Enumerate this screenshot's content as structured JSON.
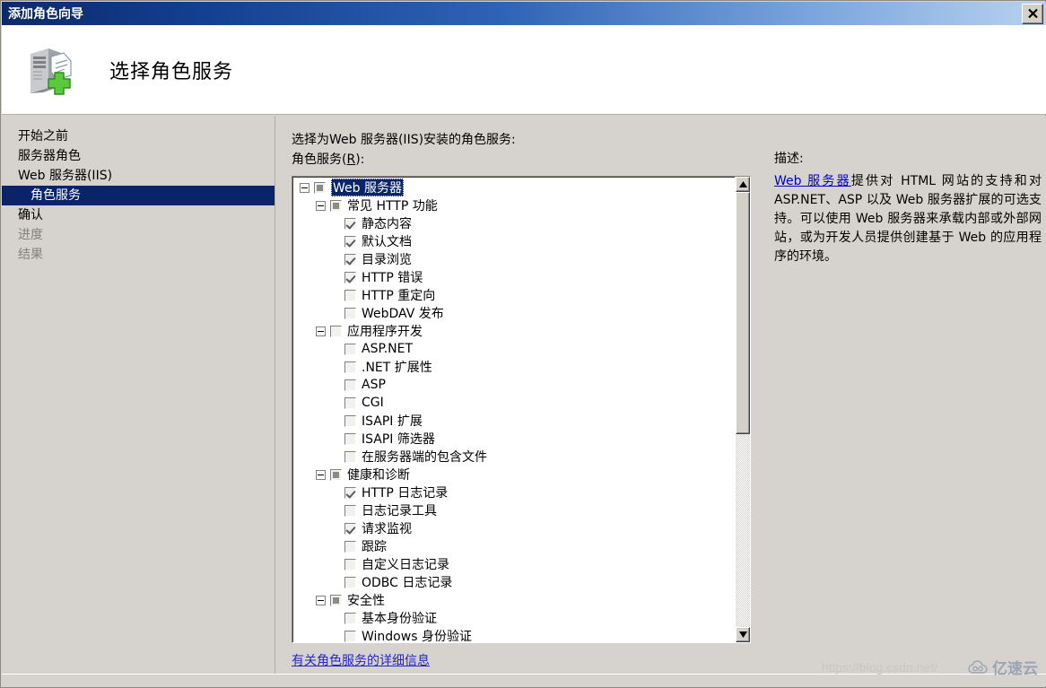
{
  "window": {
    "title": "添加角色向导",
    "close_label": "×"
  },
  "header": {
    "title": "选择角色服务",
    "icon": "server-add-icon"
  },
  "sidebar": {
    "items": [
      {
        "label": "开始之前",
        "state": "normal"
      },
      {
        "label": "服务器角色",
        "state": "normal"
      },
      {
        "label": "Web 服务器(IIS)",
        "state": "normal"
      },
      {
        "label": "角色服务",
        "state": "selected"
      },
      {
        "label": "确认",
        "state": "normal"
      },
      {
        "label": "进度",
        "state": "disabled"
      },
      {
        "label": "结果",
        "state": "disabled"
      }
    ]
  },
  "main": {
    "instruction": "选择为Web 服务器(IIS)安装的角色服务:",
    "tree_label_prefix": "角色服务(",
    "tree_label_accesskey": "R",
    "tree_label_suffix": "):",
    "more_info_link": "有关角色服务的详细信息",
    "tree": [
      {
        "label": "Web 服务器",
        "indent": 0,
        "check": "partial",
        "expander": "minus",
        "selected": true
      },
      {
        "label": "常见 HTTP 功能",
        "indent": 1,
        "check": "partial",
        "expander": "minus",
        "selected": false
      },
      {
        "label": "静态内容",
        "indent": 2,
        "check": "checked",
        "expander": "none",
        "selected": false
      },
      {
        "label": "默认文档",
        "indent": 2,
        "check": "checked",
        "expander": "none",
        "selected": false
      },
      {
        "label": "目录浏览",
        "indent": 2,
        "check": "checked",
        "expander": "none",
        "selected": false
      },
      {
        "label": "HTTP 错误",
        "indent": 2,
        "check": "checked",
        "expander": "none",
        "selected": false
      },
      {
        "label": "HTTP 重定向",
        "indent": 2,
        "check": "unchecked",
        "expander": "none",
        "selected": false
      },
      {
        "label": "WebDAV 发布",
        "indent": 2,
        "check": "unchecked",
        "expander": "none",
        "selected": false
      },
      {
        "label": "应用程序开发",
        "indent": 1,
        "check": "unchecked",
        "expander": "minus",
        "selected": false
      },
      {
        "label": "ASP.NET",
        "indent": 2,
        "check": "unchecked",
        "expander": "none",
        "selected": false
      },
      {
        "label": ".NET 扩展性",
        "indent": 2,
        "check": "unchecked",
        "expander": "none",
        "selected": false
      },
      {
        "label": "ASP",
        "indent": 2,
        "check": "unchecked",
        "expander": "none",
        "selected": false
      },
      {
        "label": "CGI",
        "indent": 2,
        "check": "unchecked",
        "expander": "none",
        "selected": false
      },
      {
        "label": "ISAPI 扩展",
        "indent": 2,
        "check": "unchecked",
        "expander": "none",
        "selected": false
      },
      {
        "label": "ISAPI 筛选器",
        "indent": 2,
        "check": "unchecked",
        "expander": "none",
        "selected": false
      },
      {
        "label": "在服务器端的包含文件",
        "indent": 2,
        "check": "unchecked",
        "expander": "none",
        "selected": false
      },
      {
        "label": "健康和诊断",
        "indent": 1,
        "check": "partial",
        "expander": "minus",
        "selected": false
      },
      {
        "label": "HTTP 日志记录",
        "indent": 2,
        "check": "checked",
        "expander": "none",
        "selected": false
      },
      {
        "label": "日志记录工具",
        "indent": 2,
        "check": "unchecked",
        "expander": "none",
        "selected": false
      },
      {
        "label": "请求监视",
        "indent": 2,
        "check": "checked",
        "expander": "none",
        "selected": false
      },
      {
        "label": "跟踪",
        "indent": 2,
        "check": "unchecked",
        "expander": "none",
        "selected": false
      },
      {
        "label": "自定义日志记录",
        "indent": 2,
        "check": "unchecked",
        "expander": "none",
        "selected": false
      },
      {
        "label": "ODBC 日志记录",
        "indent": 2,
        "check": "unchecked",
        "expander": "none",
        "selected": false
      },
      {
        "label": "安全性",
        "indent": 1,
        "check": "partial",
        "expander": "minus",
        "selected": false
      },
      {
        "label": "基本身份验证",
        "indent": 2,
        "check": "unchecked",
        "expander": "none",
        "selected": false
      },
      {
        "label": "Windows 身份验证",
        "indent": 2,
        "check": "unchecked",
        "expander": "none",
        "selected": false
      }
    ]
  },
  "description": {
    "title": "描述:",
    "link_text": "Web 服务器",
    "body": "提供对 HTML 网站的支持和对 ASP.NET、ASP 以及 Web 服务器扩展的可选支持。可以使用 Web 服务器来承载内部或外部网站，或为开发人员提供创建基于 Web 的应用程序的环境。"
  },
  "watermarks": {
    "url": "https://blog.csdn.net/",
    "brand": "亿速云"
  },
  "colors": {
    "title_bar_dark": "#0b2a6b",
    "title_bar_light": "#b8d2ef",
    "selection": "#0a246a",
    "dialog_face": "#d6d3ce",
    "link": "#2525c8"
  }
}
